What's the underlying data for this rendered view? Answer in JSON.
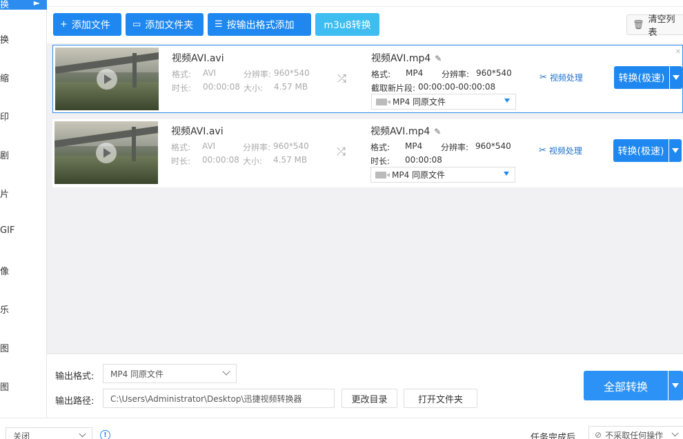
{
  "sidebar": {
    "active_item": "换",
    "items": [
      "换",
      "缩",
      "印",
      "剧",
      "片",
      "GIF",
      "像",
      "乐",
      "图",
      "图"
    ]
  },
  "toolbar": {
    "add_file": "添加文件",
    "add_folder": "添加文件夹",
    "add_by_format": "按输出格式添加",
    "m3u8": "m3u8转换",
    "clear_list": "清空列表"
  },
  "rows": [
    {
      "source_name": "视频AVI.avi",
      "format_label": "格式:",
      "format": "AVI",
      "resolution_label": "分辨率:",
      "resolution": "960*540",
      "duration_label": "时长:",
      "duration": "00:00:08",
      "size_label": "大小:",
      "size": "4.57 MB",
      "output_name": "视频AVI.mp4",
      "out_format_label": "格式:",
      "out_format": "MP4",
      "out_resolution_label": "分辨率:",
      "out_resolution": "960*540",
      "extra_label": "截取新片段:",
      "extra_value": "00:00:00-00:00:08",
      "format_select": "MP4  同原文件",
      "process_label": "视频处理",
      "convert_label": "转换(极速)"
    },
    {
      "source_name": "视频AVI.avi",
      "format_label": "格式:",
      "format": "AVI",
      "resolution_label": "分辨率:",
      "resolution": "960*540",
      "duration_label": "时长:",
      "duration": "00:00:08",
      "size_label": "大小:",
      "size": "4.57 MB",
      "output_name": "视频AVI.mp4",
      "out_format_label": "格式:",
      "out_format": "MP4",
      "out_resolution_label": "分辨率:",
      "out_resolution": "960*540",
      "extra_label": "时长:",
      "extra_value": "00:00:08",
      "format_select": "MP4  同原文件",
      "process_label": "视频处理",
      "convert_label": "转换(极速)"
    }
  ],
  "bottom": {
    "output_format_label": "输出格式:",
    "output_format_value": "MP4  同原文件",
    "output_path_label": "输出路径:",
    "output_path_value": "C:\\Users\\Administrator\\Desktop\\迅捷视频转换器",
    "change_dir": "更改目录",
    "open_folder": "打开文件夹",
    "convert_all": "全部转换"
  },
  "statusbar": {
    "close_select": "关闭",
    "info_glyph": "!",
    "after_task_label": "任务完成后",
    "after_task_value": "不采取任何操作"
  },
  "colors": {
    "accent": "#1e88f0",
    "m3u8": "#3dbdf0",
    "link": "#1e6fc9"
  }
}
